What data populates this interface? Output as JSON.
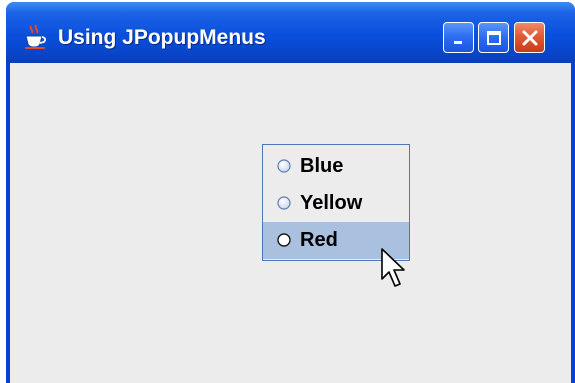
{
  "window": {
    "title": "Using JPopupMenus"
  },
  "popup_menu": {
    "items": [
      {
        "label": "Blue",
        "selected": false
      },
      {
        "label": "Yellow",
        "selected": false
      },
      {
        "label": "Red",
        "selected": true
      }
    ]
  },
  "colors": {
    "titlebar": "#0a4fdc",
    "client_background": "#ececec",
    "selected_item": "#a9c1de",
    "close_button": "#e35a36"
  },
  "icons": {
    "app": "java-coffee-cup-icon",
    "minimize": "minimize-icon",
    "maximize": "maximize-icon",
    "close": "close-icon",
    "cursor": "mouse-pointer-icon"
  }
}
